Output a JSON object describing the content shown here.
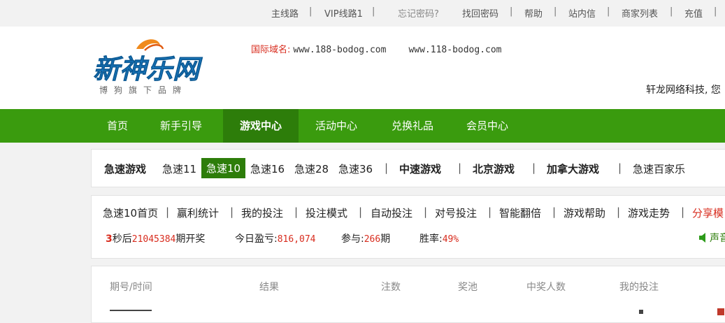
{
  "topbar": {
    "links": [
      "主线路",
      "VIP线路1",
      "忘记密码?",
      "找回密码",
      "帮助",
      "站内信",
      "商家列表",
      "充值"
    ]
  },
  "header": {
    "logo_text": "新神乐网",
    "logo_subtitle": "博狗旗下品牌",
    "domain_label": "国际域名:",
    "domain1": "www.188-bodog.com",
    "domain2": "www.118-bodog.com",
    "company": "轩龙网络科技, 您"
  },
  "nav": {
    "items": [
      "首页",
      "新手引导",
      "游戏中心",
      "活动中心",
      "兑换礼品",
      "会员中心"
    ],
    "active": "游戏中心"
  },
  "games": {
    "category1": "急速游戏",
    "items": [
      "急速11",
      "急速10",
      "急速16",
      "急速28",
      "急速36"
    ],
    "selected": "急速10",
    "category2": "中速游戏",
    "category3": "北京游戏",
    "category4": "加拿大游戏",
    "category5": "急速百家乐"
  },
  "submenu": {
    "items": [
      "急速10首页",
      "赢利统计",
      "我的投注",
      "投注模式",
      "自动投注",
      "对号投注",
      "智能翻倍",
      "游戏帮助",
      "游戏走势",
      "分享模"
    ]
  },
  "status": {
    "countdown": "3",
    "countdown_suffix": "秒后",
    "period": "21045384",
    "period_suffix": "期开奖",
    "today_label": "今日盈亏:",
    "today_value": "816,074",
    "participate_label": "参与:",
    "participate_value": "266",
    "participate_unit": "期",
    "winrate_label": "胜率:",
    "winrate_value": "49%",
    "sound": "声音"
  },
  "table": {
    "headers": [
      "期号/时间",
      "结果",
      "注数",
      "奖池",
      "中奖人数",
      "我的投注"
    ]
  },
  "colors": {
    "nav_bg": "#3a9b0e",
    "nav_active": "#2d7d0a",
    "accent_red": "#d82c1e"
  }
}
